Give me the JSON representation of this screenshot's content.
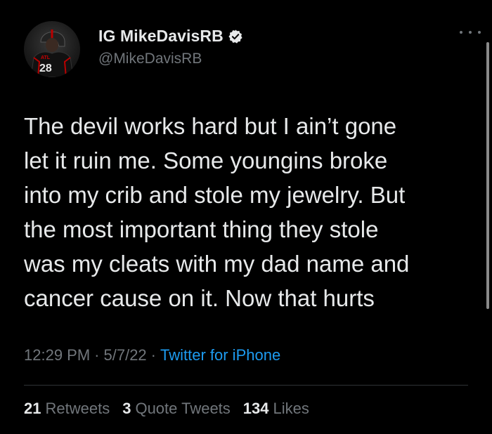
{
  "tweet": {
    "author": {
      "display_name": "IG MikeDavisRB",
      "handle": "@MikeDavisRB",
      "verified": true,
      "avatar_icon": "football-player-avatar"
    },
    "text": "The devil works hard but I ain’t gone\nlet it ruin me. Some youngins broke\ninto my crib and stole my jewelry. But\nthe most important thing they stole\nwas my cleats with my dad name and\ncancer cause on it. Now that hurts",
    "time": "12:29 PM",
    "date": "5/7/22",
    "separator": "·",
    "source": "Twitter for iPhone",
    "stats": {
      "retweets": {
        "count": "21",
        "label": "Retweets"
      },
      "quotes": {
        "count": "3",
        "label": "Quote Tweets"
      },
      "likes": {
        "count": "134",
        "label": "Likes"
      }
    }
  },
  "colors": {
    "background": "#000000",
    "text": "#e7e9ea",
    "secondary": "#71767b",
    "accent": "#1d9bf0"
  }
}
